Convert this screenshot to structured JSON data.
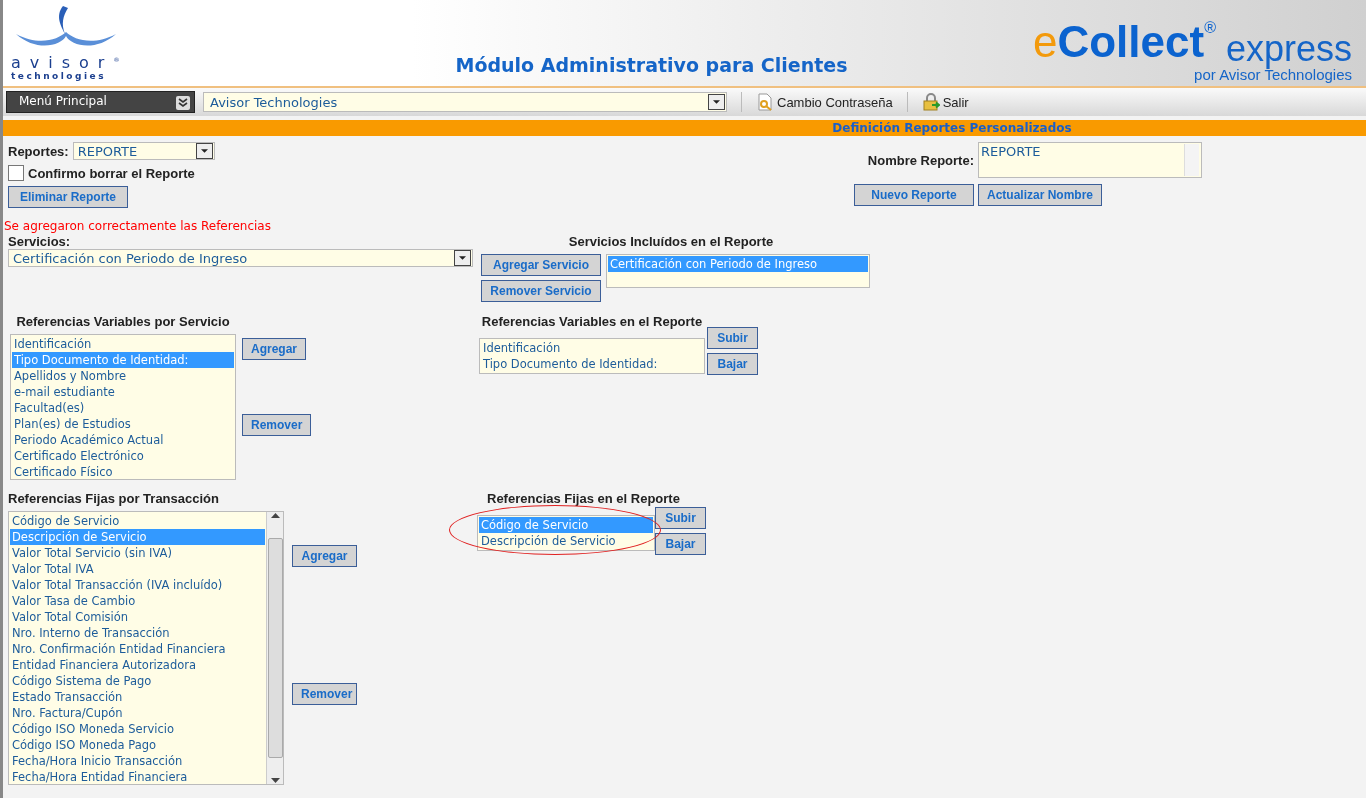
{
  "header": {
    "logo_name": "avisor",
    "logo_mark": "®",
    "logo_sub": "technologies",
    "title": "Módulo Administrativo para Clientes",
    "brand_e": "e",
    "brand_main": "Collect",
    "brand_mark": "®",
    "brand_express": "express",
    "brand_sub": "por Avisor Technologies"
  },
  "toolbar": {
    "menu": "Menú Principal",
    "company": "Avisor Technologies",
    "links": [
      {
        "kind": "password",
        "label": "Cambio Contraseña"
      },
      {
        "kind": "logout",
        "label": "Salir"
      }
    ]
  },
  "section_title": "Definición Reportes Personalizados",
  "report": {
    "label": "Reportes:",
    "value": "REPORTE",
    "confirm": {
      "label": "Confirmo borrar el Reporte",
      "checked": false
    },
    "delete_button": "Eliminar Reporte",
    "name_label": "Nombre Reporte:",
    "name_value": "REPORTE",
    "buttons": [
      "Nuevo Reporte",
      "Actualizar Nombre"
    ]
  },
  "message": "Se agregaron correctamente las Referencias",
  "services": {
    "label": "Servicios:",
    "value": "Certificación con Periodo de Ingreso",
    "buttons": [
      "Agregar Servicio",
      "Remover Servicio"
    ],
    "included_title": "Servicios Incluídos en el Reporte",
    "included": [
      {
        "label": "Certificación con Periodo de Ingreso",
        "selected": true
      }
    ]
  },
  "variable_refs": {
    "title": "Referencias Variables por Servicio",
    "items": [
      {
        "label": "Identificación",
        "selected": false
      },
      {
        "label": "Tipo Documento de Identidad:",
        "selected": true
      },
      {
        "label": "Apellidos y Nombre",
        "selected": false
      },
      {
        "label": "e-mail estudiante",
        "selected": false
      },
      {
        "label": "Facultad(es)",
        "selected": false
      },
      {
        "label": "Plan(es) de Estudios",
        "selected": false
      },
      {
        "label": "Periodo Académico Actual",
        "selected": false
      },
      {
        "label": "Certificado Electrónico",
        "selected": false
      },
      {
        "label": "Certificado Físico",
        "selected": false
      }
    ],
    "buttons": [
      "Agregar",
      "Remover"
    ],
    "report_title": "Referencias Variables en el Reporte",
    "report_items": [
      {
        "label": "Identificación",
        "selected": false
      },
      {
        "label": "Tipo Documento de Identidad:",
        "selected": false
      }
    ],
    "order_buttons": [
      "Subir",
      "Bajar"
    ]
  },
  "fixed_refs": {
    "title": "Referencias Fijas por Transacción",
    "items": [
      {
        "label": "Código de Servicio",
        "selected": false
      },
      {
        "label": "Descripción de Servicio",
        "selected": true
      },
      {
        "label": "Valor Total Servicio (sin IVA)",
        "selected": false
      },
      {
        "label": "Valor Total IVA",
        "selected": false
      },
      {
        "label": "Valor Total Transacción (IVA incluído)",
        "selected": false
      },
      {
        "label": "Valor Tasa de Cambio",
        "selected": false
      },
      {
        "label": "Valor Total Comisión",
        "selected": false
      },
      {
        "label": "Nro. Interno de Transacción",
        "selected": false
      },
      {
        "label": "Nro. Confirmación Entidad Financiera",
        "selected": false
      },
      {
        "label": "Entidad Financiera Autorizadora",
        "selected": false
      },
      {
        "label": "Código Sistema de Pago",
        "selected": false
      },
      {
        "label": "Estado Transacción",
        "selected": false
      },
      {
        "label": "Nro. Factura/Cupón",
        "selected": false
      },
      {
        "label": "Código ISO Moneda Servicio",
        "selected": false
      },
      {
        "label": "Código ISO Moneda Pago",
        "selected": false
      },
      {
        "label": "Fecha/Hora Inicio Transacción",
        "selected": false
      },
      {
        "label": "Fecha/Hora Entidad Financiera",
        "selected": false
      }
    ],
    "buttons": [
      "Agregar",
      "Remover"
    ],
    "report_title": "Referencias Fijas en el Reporte",
    "report_items": [
      {
        "label": "Código de Servicio",
        "selected": true
      },
      {
        "label": "Descripción de Servicio",
        "selected": false
      }
    ],
    "order_buttons": [
      "Subir",
      "Bajar"
    ]
  }
}
